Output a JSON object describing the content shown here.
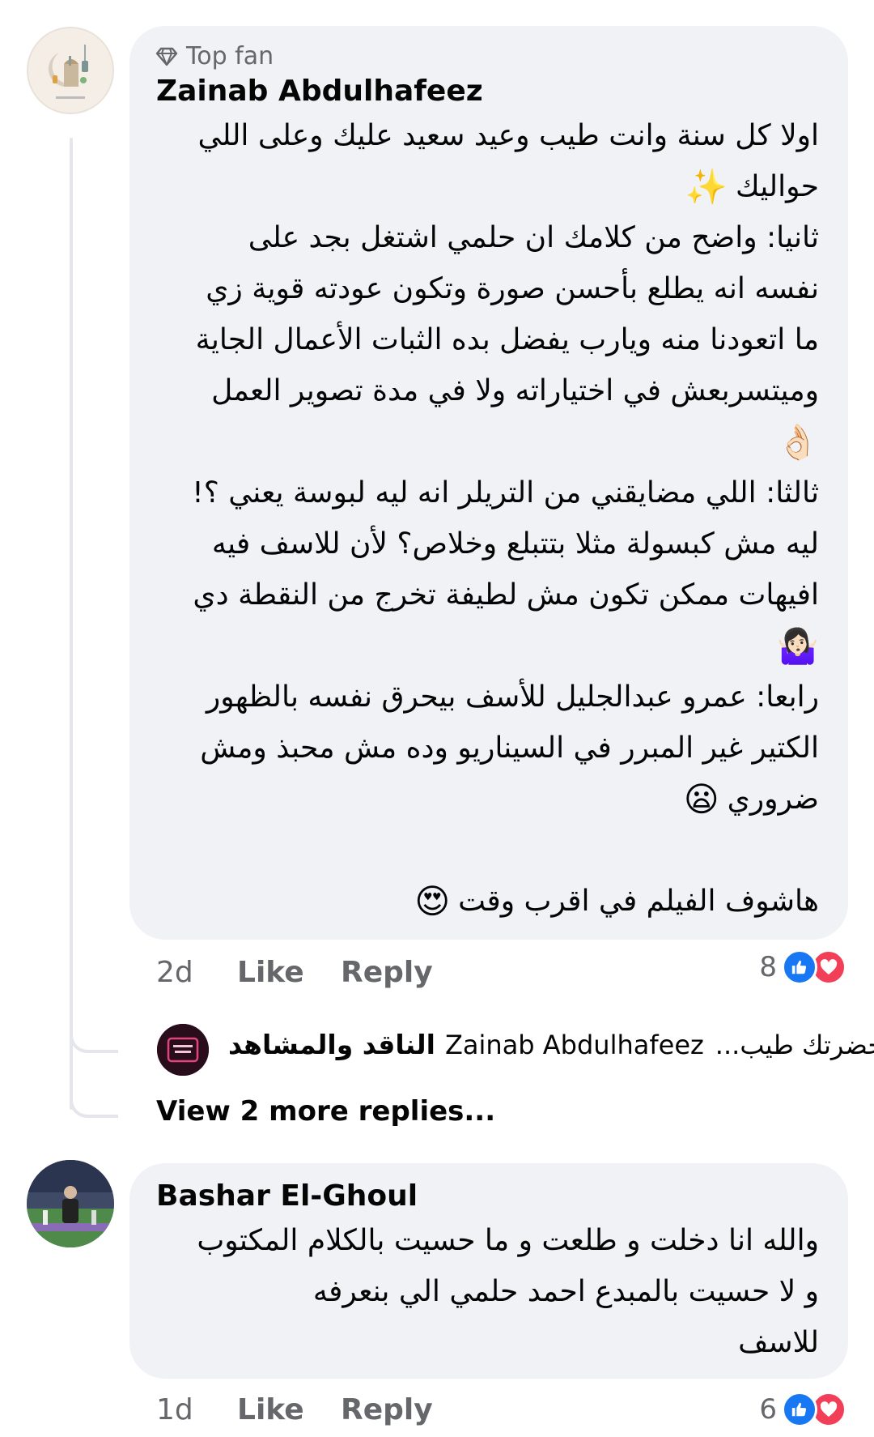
{
  "comment1": {
    "badge": "Top fan",
    "author": "Zainab Abdulhafeez",
    "lines": [
      {
        "text": "اولا كل سنة وانت طيب وعيد سعيد عليك وعلى اللي",
        "emoji": ""
      },
      {
        "text": "حواليك",
        "emoji": "✨"
      },
      {
        "text": "ثانيا: واضح من كلامك ان حلمي اشتغل بجد على",
        "emoji": ""
      },
      {
        "text": "نفسه انه يطلع بأحسن صورة وتكون عودته قوية زي",
        "emoji": ""
      },
      {
        "text": "ما اتعودنا منه ويارب يفضل بده الثبات الأعمال الجاية",
        "emoji": ""
      },
      {
        "text": "وميتسربعش في اختياراته ولا في مدة تصوير العمل",
        "emoji": ""
      },
      {
        "text": "",
        "emoji": "👌🏻"
      },
      {
        "text": "ثالثا: اللي مضايقني من التريلر انه ليه لبوسة يعني ؟!",
        "emoji": ""
      },
      {
        "text": "ليه مش كبسولة مثلا بتتبلع وخلاص؟ لأن للاسف فيه",
        "emoji": ""
      },
      {
        "text": "افيهات ممكن تكون مش لطيفة تخرج من النقطة دي",
        "emoji": ""
      },
      {
        "text": "",
        "emoji": "🤷🏻‍♀️"
      },
      {
        "text": "رابعا: عمرو عبدالجليل للأسف بيحرق نفسه بالظهور",
        "emoji": ""
      },
      {
        "text": "الكتير غير المبرر في السيناريو وده مش محبذ ومش",
        "emoji": ""
      },
      {
        "text": "ضروري",
        "emoji": "😦"
      },
      {
        "text": "",
        "emoji": ""
      },
      {
        "text": "هاشوف الفيلم في اقرب وقت",
        "emoji": "😍"
      }
    ],
    "time": "2d",
    "like_label": "Like",
    "reply_label": "Reply",
    "reaction_count": "8",
    "reaction_icons": [
      "like-icon",
      "love-icon"
    ]
  },
  "reply_preview": {
    "page_name": "الناقد والمشاهد",
    "mention": "Zainab Abdulhafeez",
    "text": "وحضرتك طيب...",
    "avatar_text": "الناقد والمشاهد"
  },
  "view_more": "View 2 more replies...",
  "comment2": {
    "author": "Bashar El-Ghoul",
    "lines": [
      {
        "text": "والله انا دخلت و طلعت و ما حسيت بالكلام المكتوب",
        "emoji": ""
      },
      {
        "text": "و لا حسيت بالمبدع احمد حلمي الي بنعرفه",
        "emoji": ""
      },
      {
        "text": "للاسف",
        "emoji": ""
      }
    ],
    "time": "1d",
    "like_label": "Like",
    "reply_label": "Reply",
    "reaction_count": "6",
    "reaction_icons": [
      "like-icon",
      "love-icon"
    ]
  },
  "colors": {
    "bubble": "#f0f2f5",
    "secondary_text": "#65676b",
    "like_blue": "#1877f2",
    "love_red": "#f33e58",
    "thread_line": "#e4e6eb"
  }
}
